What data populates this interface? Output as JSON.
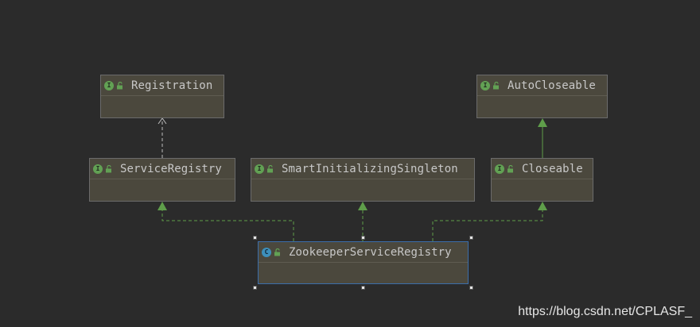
{
  "diagram": {
    "nodes": {
      "registration": {
        "title": "Registration",
        "kind": "I"
      },
      "auto_closeable": {
        "title": "AutoCloseable",
        "kind": "I"
      },
      "service_registry": {
        "title": "ServiceRegistry",
        "kind": "I"
      },
      "smart_init_singleton": {
        "title": "SmartInitializingSingleton",
        "kind": "I"
      },
      "closeable": {
        "title": "Closeable",
        "kind": "I"
      },
      "zookeeper_service_registry": {
        "title": "ZookeeperServiceRegistry",
        "kind": "C"
      }
    },
    "edges": [
      {
        "from": "service_registry",
        "to": "registration",
        "style": "dashed-open-arrow"
      },
      {
        "from": "closeable",
        "to": "auto_closeable",
        "style": "solid-filled-arrow"
      },
      {
        "from": "zookeeper_service_registry",
        "to": "service_registry",
        "style": "dashed-filled-arrow"
      },
      {
        "from": "zookeeper_service_registry",
        "to": "smart_init_singleton",
        "style": "dashed-filled-arrow"
      },
      {
        "from": "zookeeper_service_registry",
        "to": "closeable",
        "style": "dashed-filled-arrow"
      }
    ]
  },
  "colors": {
    "background": "#2b2b2b",
    "node_fill": "#4b483d",
    "interface_badge": "#62a154",
    "class_badge": "#3d8fbb",
    "realization_edge": "#5f9e4a",
    "dependency_edge": "#bdbdbd",
    "selection": "#3b6eab"
  },
  "watermark": "https://blog.csdn.net/CPLASF_"
}
